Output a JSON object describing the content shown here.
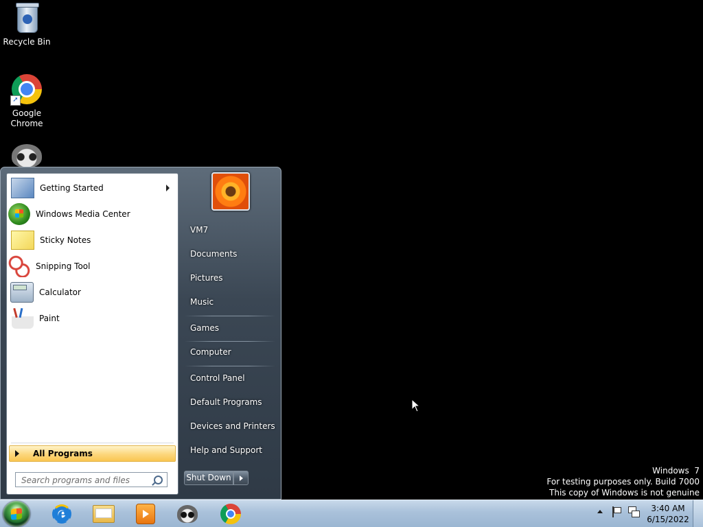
{
  "desktop": {
    "icons": [
      {
        "label": "Recycle Bin",
        "icon": "recycle-bin-icon"
      },
      {
        "label": "Google\nChrome",
        "icon": "chrome-icon"
      },
      {
        "label": "",
        "icon": "raccoon-icon"
      }
    ]
  },
  "start_menu": {
    "programs": [
      {
        "label": "Getting Started",
        "icon": "getting-started-icon",
        "has_submenu": true
      },
      {
        "label": "Windows Media Center",
        "icon": "windows-media-center-icon"
      },
      {
        "label": "Sticky Notes",
        "icon": "sticky-notes-icon"
      },
      {
        "label": "Snipping Tool",
        "icon": "snipping-tool-icon"
      },
      {
        "label": "Calculator",
        "icon": "calculator-icon"
      },
      {
        "label": "Paint",
        "icon": "paint-icon"
      }
    ],
    "all_programs_label": "All Programs",
    "search_placeholder": "Search programs and files",
    "right_items": {
      "user": "VM7",
      "documents": "Documents",
      "pictures": "Pictures",
      "music": "Music",
      "games": "Games",
      "computer": "Computer",
      "control_panel": "Control Panel",
      "default_programs": "Default Programs",
      "devices_printers": "Devices and Printers",
      "help_support": "Help and Support"
    },
    "shutdown_label": "Shut Down"
  },
  "watermark": {
    "line1": "Windows  7",
    "line2": "For testing purposes only. Build 7000",
    "line3": "This copy of Windows is not genuine"
  },
  "taskbar": {
    "pinned": [
      "internet-explorer-icon",
      "windows-explorer-icon",
      "windows-media-player-icon",
      "raccoon-app-icon",
      "chrome-icon"
    ],
    "clock_time": "3:40 AM",
    "clock_date": "6/15/2022"
  },
  "colors": {
    "taskbar": "#a9c1da",
    "all_programs_highlight": "#fcd77c",
    "desktop": "#000000"
  }
}
